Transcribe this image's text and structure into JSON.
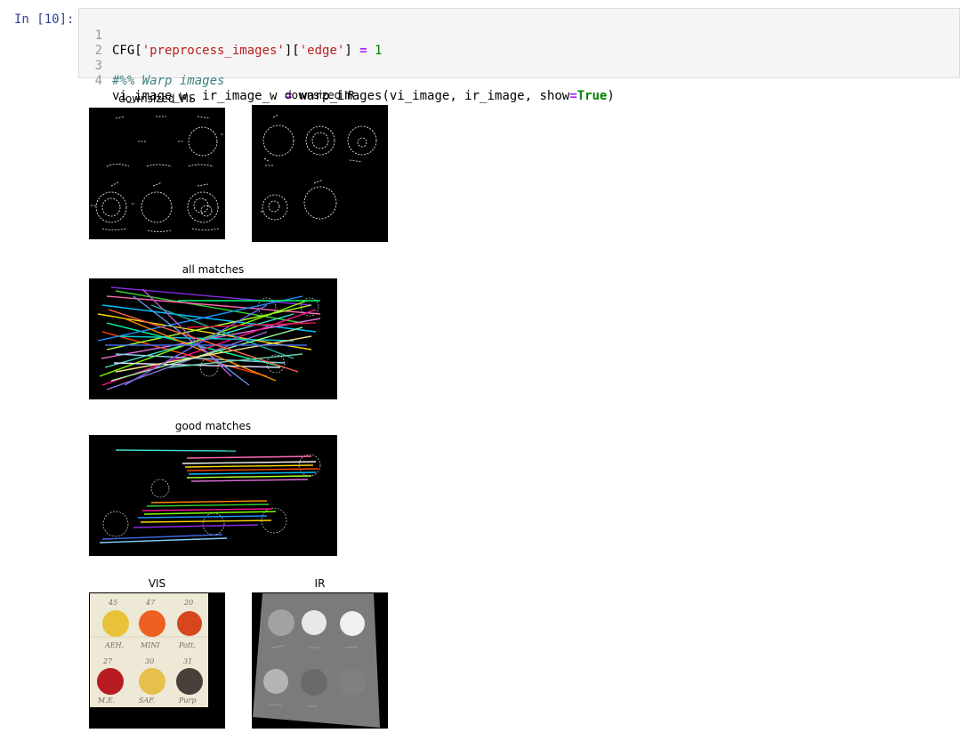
{
  "cell": {
    "prompt": "In [10]:",
    "lines": [
      {
        "num": "1",
        "parts": [
          "CFG[",
          "'preprocess_images'",
          "][",
          "'edge'",
          "] ",
          "=",
          " ",
          "1"
        ]
      },
      {
        "num": "2",
        "parts": [
          ""
        ]
      },
      {
        "num": "3",
        "parts": [
          "#%% Warp images"
        ]
      },
      {
        "num": "4",
        "parts": [
          "vi_image_w, ir_image_w ",
          "=",
          " warp_images(vi_image, ir_image, show",
          "=",
          "True",
          ")"
        ]
      }
    ]
  },
  "figures": {
    "downsized_vis": {
      "title": "downsized VIS"
    },
    "downsized_ir": {
      "title": "downsized IR"
    },
    "all_matches": {
      "title": "all matches"
    },
    "good_matches": {
      "title": "good matches"
    },
    "vis": {
      "title": "VIS",
      "labels": [
        "45",
        "47",
        "20",
        "AEH.",
        "MINI",
        "Pott.",
        "27",
        "30",
        "31",
        "M.E.",
        "SAF.",
        "Purp"
      ]
    },
    "ir": {
      "title": "IR"
    }
  }
}
